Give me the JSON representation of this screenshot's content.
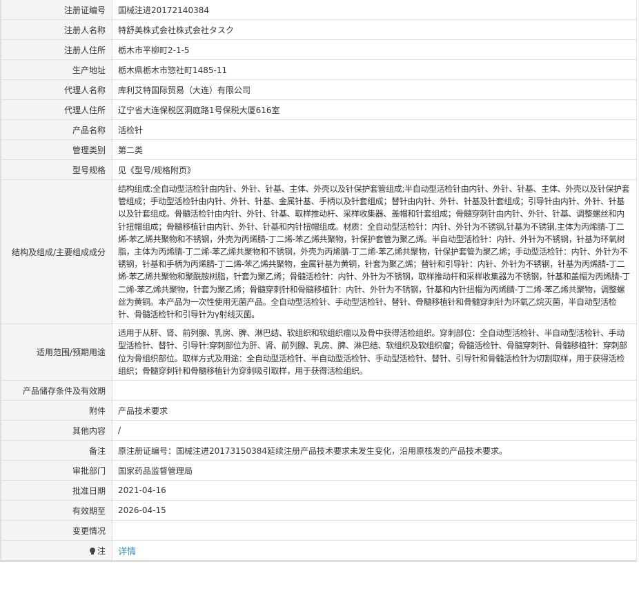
{
  "rows": [
    {
      "label": "注册证编号",
      "value": "国械注进20172140384"
    },
    {
      "label": "注册人名称",
      "value": "特舒美株式会社株式会社タスク"
    },
    {
      "label": "注册人住所",
      "value": "栃木市平柳町2-1-5"
    },
    {
      "label": "生产地址",
      "value": "栃木県栃木市惣社町1485-11"
    },
    {
      "label": "代理人名称",
      "value": "库利艾特国际贸易（大连）有限公司"
    },
    {
      "label": "代理人住所",
      "value": "辽宁省大连保税区洞庭路1号保税大厦616室"
    },
    {
      "label": "产品名称",
      "value": "活检针"
    },
    {
      "label": "管理类别",
      "value": "第二类"
    },
    {
      "label": "型号规格",
      "value": "见《型号/规格附页》"
    },
    {
      "label": "结构及组成/主要组成成分",
      "value": "结构组成:全自动型活检针由内针、外针、针基、主体、外壳以及针保护套管组成;半自动型活检针由内针、外针、针基、主体、外壳以及针保护套管组成；手动型活检针由内针、外针、针基、金属针基、手柄以及针套组成；替针由内针、外针、针基及针套组成；引导针由内针、外针、针基以及针套组成。骨髓活检针由内针、外针、针基、取样推动杆、采样收集器、盖帽和针套组成；骨髓穿刺针由内针、外针、针基、调整螺丝和内针扭帽组成；骨髓移植针由内针、外针、针基和内针扭帽组成。材质：全自动型活检针：内针、外针为不锈钢,针基为不锈钢,主体为丙烯腈-丁二烯-苯乙烯共聚物和不锈钢，外壳为丙烯腈-丁二烯-苯乙烯共聚物，针保护套管为聚乙烯。半自动型活检针：内针、外针为不锈钢，针基为环氧树脂，主体为丙烯腈-丁二烯-苯乙烯共聚物和不锈钢，外壳为丙烯腈-丁二烯-苯乙烯共聚物，针保护套管为聚乙烯；手动型活检针：内针、外针为不锈钢，针基和手柄为丙烯腈-丁二烯-苯乙烯共聚物，金属针基为黄铜，针套为聚乙烯；替针和引导针：内针、外针为不锈钢，针基为丙烯腈-丁二烯-苯乙烯共聚物和聚酰胺树脂，针套为聚乙烯；骨髓活检针：内针、外针为不锈钢，取样推动杆和采样收集器为不锈钢，针基和盖帽为丙烯腈-丁二烯-苯乙烯共聚物，针套为聚乙烯；骨髓穿刺针和骨髓移植针：内针、外针为不锈钢，针基和内针扭帽为丙烯腈-丁二烯-苯乙烯共聚物，调整螺丝为黄铜。本产品为一次性使用无菌产品。全自动型活检针、手动型活检针、替针、骨髓移植针和骨髓穿刺针为环氧乙烷灭菌，半自动型活检针、骨髓活检针和引导针为γ射线灭菌。"
    },
    {
      "label": "适用范围/预期用途",
      "value": "适用于从肝、肾、前列腺、乳房、脾、淋巴结、软组织和软组织瘤以及骨中获得活检组织。穿刺部位：全自动型活检针、半自动型活检针、手动型活检针、替针、引导针:穿刺部位为肝、肾、前列腺、乳房、脾、淋巴结、软组织及软组织瘤；骨髓活检针、骨髓穿刺针、骨髓移植针：穿刺部位为骨组织部位。取样方式及用途：全自动型活检针、半自动型活检针、手动型活检针、替针、引导针和骨髓活检针为切割取样，用于获得活检组织；骨髓穿刺针和骨髓移植针为穿刺吸引取样，用于获得活检组织。"
    },
    {
      "label": "产品储存条件及有效期",
      "value": ""
    },
    {
      "label": "附件",
      "value": "产品技术要求"
    },
    {
      "label": "其他内容",
      "value": "/"
    },
    {
      "label": "备注",
      "value": "原注册证编号：国械注进20173150384延续注册产品技术要求未发生变化，沿用原核发的产品技术要求。"
    },
    {
      "label": "审批部门",
      "value": "国家药品监督管理局"
    },
    {
      "label": "批准日期",
      "value": "2021-04-16"
    },
    {
      "label": "有效期至",
      "value": "2026-04-15"
    },
    {
      "label": "变更情况",
      "value": ""
    }
  ],
  "note": {
    "label": "注",
    "icon": "lightbulb-icon",
    "link": "详情",
    "link_color": "#3e8ed0"
  }
}
